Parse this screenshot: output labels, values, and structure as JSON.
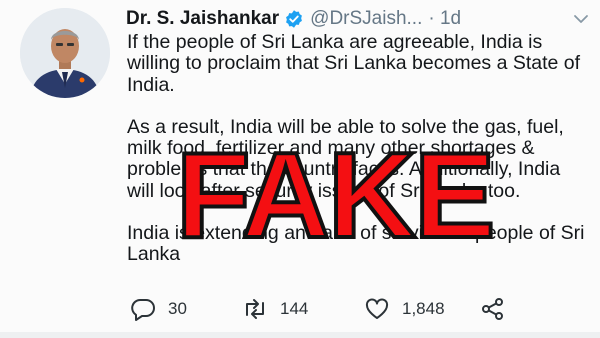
{
  "tweet": {
    "author_name": "Dr. S. Jaishankar",
    "handle": "@DrSJaish...",
    "timestamp": "· 1d",
    "paragraphs": [
      "If the people of Sri Lanka are agreeable, India is willing to proclaim that Sri Lanka becomes a State of India.",
      "As a result, India will be able to solve the gas, fuel, milk food, fertilizer and many other shortages & problems that the country faces. Additionally, India will look after security issues of Sri Lanka too.",
      "India is extending an hand of survival to people of Sri Lanka"
    ],
    "icons": {
      "avatar": "avatar",
      "verified": "verified-badge-icon",
      "more": "chevron-down-icon"
    },
    "actions": {
      "reply_count": "30",
      "retweet_count": "144",
      "like_count": "1,848"
    }
  },
  "overlay": {
    "stamp_text": "FAKE",
    "stamp_color": "#f40f12"
  },
  "colors": {
    "verified": "#1da1f2",
    "text": "#14171a",
    "muted": "#657786"
  }
}
